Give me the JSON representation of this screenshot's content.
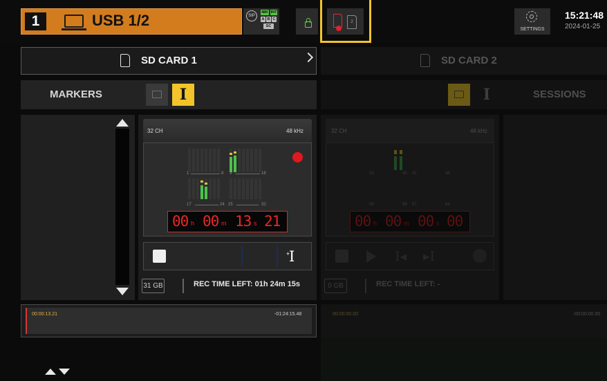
{
  "source": {
    "number": "1",
    "label": "USB 1/2"
  },
  "status": {
    "sip": "SIP",
    "rate_tag": "48K",
    "int_tag": "INT",
    "tags": [
      "A",
      "B",
      "C"
    ],
    "sc_tag": "SC"
  },
  "sd_icon_label": "2",
  "settings_label": "SETTINGS",
  "clock": {
    "time": "15:21:48",
    "date": "2024-01-25"
  },
  "card1": {
    "title": "SD CARD 1",
    "tab_markers": "MARKERS",
    "ch_count": "32 CH",
    "sample_rate": "48 kHz",
    "scale_top": [
      "1",
      "8",
      "9",
      "16"
    ],
    "scale_bottom": [
      "17",
      "24",
      "25",
      "32"
    ],
    "timecode": {
      "h": "00",
      "m": "00",
      "s": "13",
      "f": "21",
      "h_unit": "h",
      "m_unit": "m",
      "s_unit": "s"
    },
    "free_space": "31 GB",
    "rec_time_left": "REC TIME LEFT:  01h 24m 15s",
    "timeline_start": "00:00:13.21",
    "timeline_end": "-01:24:15.48"
  },
  "card2": {
    "title": "SD CARD 2",
    "tab_sessions": "SESSIONS",
    "ch_count": "32 CH",
    "sample_rate": "48 kHz",
    "scale_top": [
      "33",
      "40",
      "41",
      "48"
    ],
    "scale_bottom": [
      "49",
      "56",
      "57",
      "64"
    ],
    "timecode": {
      "h": "00",
      "m": "00",
      "s": "00",
      "f": "00",
      "h_unit": "h",
      "m_unit": "m",
      "s_unit": "s"
    },
    "free_space": "0 GB",
    "rec_time_left": "REC TIME LEFT:  -",
    "timeline_start": "00:00:00.00",
    "timeline_end": "-00:00:00.00"
  },
  "colors": {
    "accent_orange": "#d27c1e",
    "highlight_yellow": "#f2c429",
    "rec_red": "#e1181f",
    "meter_green": "#4cc34d"
  }
}
